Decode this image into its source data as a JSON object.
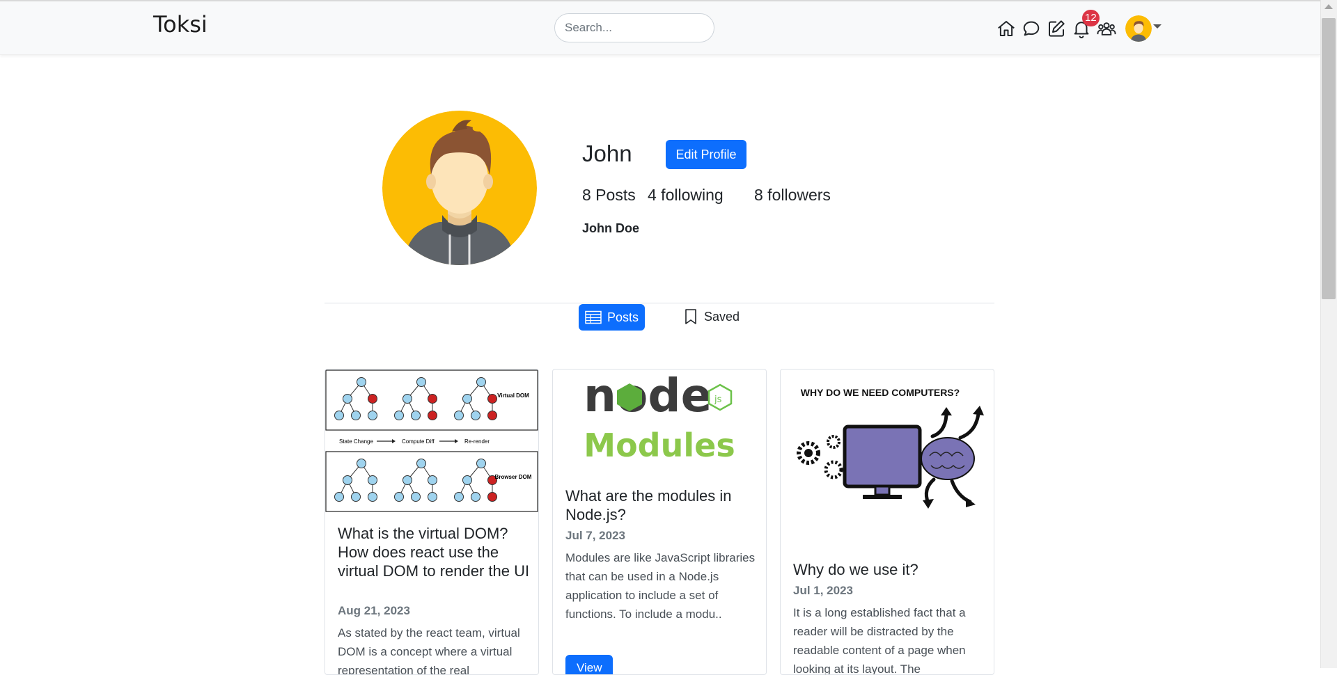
{
  "nav": {
    "brand": "Toksi",
    "search_placeholder": "Search...",
    "notification_count": "12"
  },
  "profile": {
    "username": "John",
    "edit_label": "Edit Profile",
    "posts_count": "8 Posts",
    "following": "4 following",
    "followers": "8 followers",
    "full_name": "John Doe"
  },
  "tabs": {
    "posts": "Posts",
    "saved": "Saved"
  },
  "posts": [
    {
      "title": "What is the virtual DOM? How does react use the virtual DOM to render the UI",
      "date": "Aug 21, 2023",
      "excerpt": "As stated by the react team, virtual DOM is a concept where a virtual representation of the real",
      "image_labels": {
        "top": "Virtual DOM",
        "bottom": "Browser DOM",
        "flow": [
          "State Change",
          "Compute Diff",
          "Re-render"
        ]
      }
    },
    {
      "title": "What are the modules in Node.js?",
      "date": "Jul 7, 2023",
      "excerpt": "Modules are like JavaScript libraries that can be used in a Node.js application to include a set of functions. To include a modu..",
      "view_label": "View",
      "image_labels": {
        "logo": "node",
        "sub": "Modules"
      }
    },
    {
      "title": "Why do we use it?",
      "date": "Jul 1, 2023",
      "excerpt": "It is a long established fact that a reader will be distracted by the readable content of a page when looking at its layout. The",
      "image_labels": {
        "heading": "WHY DO WE NEED COMPUTERS?"
      }
    }
  ],
  "colors": {
    "primary": "#0d6efd",
    "badge": "#dc3545",
    "avatar_bg": "#fcbc04"
  }
}
